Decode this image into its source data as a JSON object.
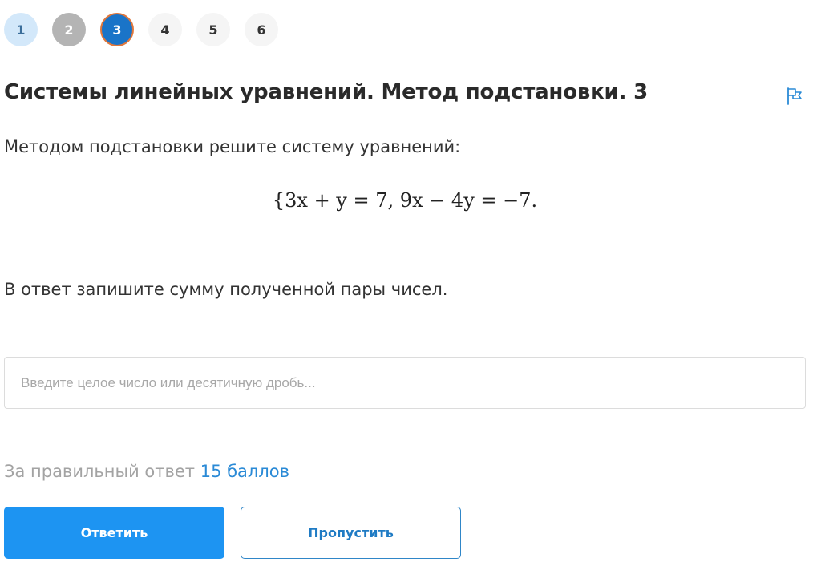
{
  "steps": [
    {
      "label": "1",
      "state": "done-correct"
    },
    {
      "label": "2",
      "state": "done-skipped"
    },
    {
      "label": "3",
      "state": "current"
    },
    {
      "label": "4",
      "state": "pending"
    },
    {
      "label": "5",
      "state": "pending"
    },
    {
      "label": "6",
      "state": "pending"
    }
  ],
  "task": {
    "title": "Системы линейных уравнений. Метод подстановки. 3",
    "prompt": "Методом подстановки решите систему уравнений:",
    "equation": "{3x + y = 7, 9x − 4y = −7.",
    "instruction": "В ответ запишите сумму полученной пары чисел."
  },
  "answer": {
    "placeholder": "Введите целое число или десятичную дробь...",
    "value": ""
  },
  "points": {
    "prefix": "За правильный ответ",
    "amount": "15 баллов"
  },
  "buttons": {
    "submit_label": "Ответить",
    "skip_label": "Пропустить"
  },
  "icons": {
    "flag": "flag-icon"
  },
  "colors": {
    "accent": "#1d94f2",
    "current_step": "#1a74c8",
    "current_step_ring": "#e0773c",
    "link": "#2a8ad6"
  }
}
